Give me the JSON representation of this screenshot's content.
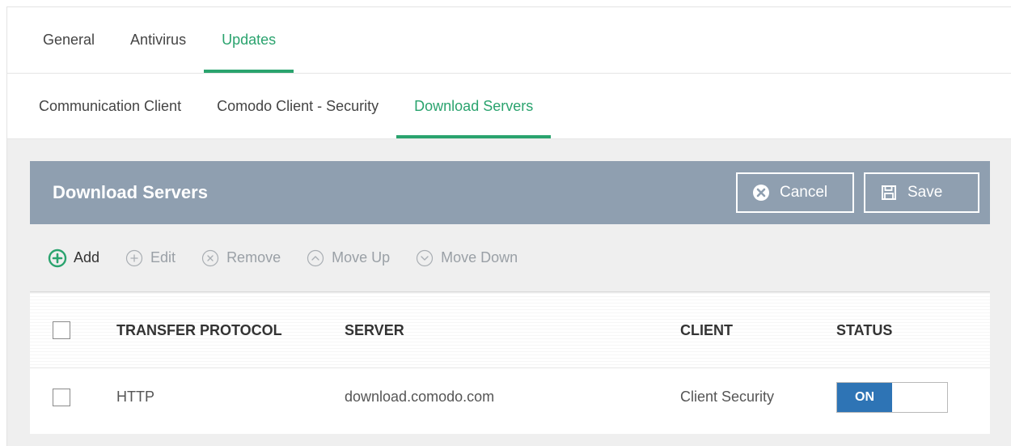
{
  "primary_tabs": [
    {
      "label": "General"
    },
    {
      "label": "Antivirus"
    },
    {
      "label": "Updates",
      "active": true
    }
  ],
  "secondary_tabs": [
    {
      "label": "Communication Client"
    },
    {
      "label": "Comodo Client - Security"
    },
    {
      "label": "Download Servers",
      "active": true
    }
  ],
  "panel": {
    "title": "Download Servers",
    "cancel_label": "Cancel",
    "save_label": "Save"
  },
  "toolbar": {
    "add": "Add",
    "edit": "Edit",
    "remove": "Remove",
    "move_up": "Move Up",
    "move_down": "Move Down"
  },
  "table": {
    "columns": [
      "TRANSFER PROTOCOL",
      "SERVER",
      "CLIENT",
      "STATUS"
    ],
    "rows": [
      {
        "protocol": "HTTP",
        "server": "download.comodo.com",
        "client": "Client Security",
        "status": "ON"
      }
    ]
  },
  "colors": {
    "accent_green": "#2aa36e",
    "header_bar": "#8f9fb0",
    "toggle_on": "#2e74b5"
  },
  "icons": {
    "cancel": "close-circle-icon",
    "save": "floppy-disk-icon",
    "add": "plus-circle-icon",
    "edit": "plus-circle-outline-icon",
    "remove": "x-circle-outline-icon",
    "move_up": "chevron-up-circle-icon",
    "move_down": "chevron-down-circle-icon"
  }
}
